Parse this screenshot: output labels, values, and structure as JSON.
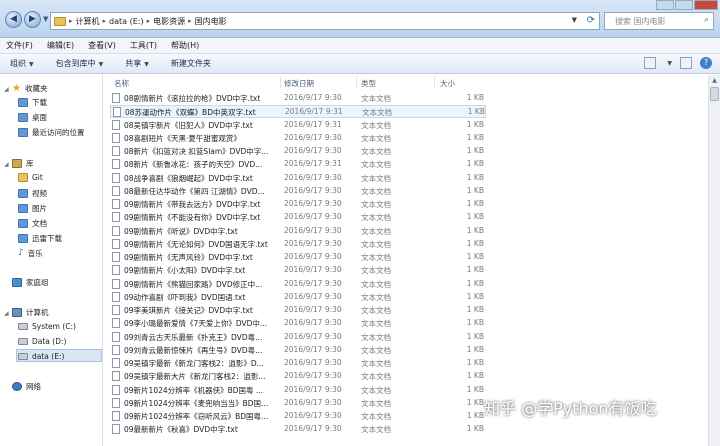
{
  "address_bar": {
    "crumbs": [
      "计算机",
      "data (E:)",
      "电影资源",
      "国内电影"
    ],
    "search_placeholder": "搜索 国内电影"
  },
  "menu": [
    "文件(F)",
    "编辑(E)",
    "查看(V)",
    "工具(T)",
    "帮助(H)"
  ],
  "toolbar": {
    "organize": "组织",
    "include": "包含到库中",
    "share": "共享",
    "new_folder": "新建文件夹"
  },
  "nav": {
    "favorites": "收藏夹",
    "downloads": "下载",
    "desktop": "桌面",
    "recent": "最近访问的位置",
    "libraries": "库",
    "git": "Git",
    "videos": "视频",
    "pictures": "图片",
    "documents": "文档",
    "thunder": "迅雷下载",
    "music": "音乐",
    "homegroup": "家庭组",
    "computer": "计算机",
    "drive_c": "System (C:)",
    "drive_d": "Data (D:)",
    "drive_e": "data (E:)",
    "network": "网络"
  },
  "columns": {
    "name": "名称",
    "date": "修改日期",
    "type": "类型",
    "size": "大小"
  },
  "files": [
    {
      "name": "08剧情新片《滚拉拉的枪》DVD中字.txt",
      "date": "2016/9/17 9:30",
      "type": "文本文档",
      "size": "1 KB"
    },
    {
      "name": "08苏運动作片《双蝶》BD中英双字.txt",
      "date": "2016/9/17 9:31",
      "type": "文本文档",
      "size": "1 KB"
    },
    {
      "name": "08吴镇宇新片《旧犯人》DVD中字.txt",
      "date": "2016/9/17 9:31",
      "type": "文本文档",
      "size": "1 KB"
    },
    {
      "name": "08喜剧短片《天黑·夏午甜蜜观赏》",
      "date": "2016/9/17 9:30",
      "type": "文本文档",
      "size": "1 KB"
    },
    {
      "name": "08新片《扣篮对决 扣篮Slam》DVD中字...",
      "date": "2016/9/17 9:30",
      "type": "文本文档",
      "size": "1 KB"
    },
    {
      "name": "08新片《新鲁冰花：孩子的天空》DVD...",
      "date": "2016/9/17 9:31",
      "type": "文本文档",
      "size": "1 KB"
    },
    {
      "name": "08战争喜剧《狼烟崛起》DVD中字.txt",
      "date": "2016/9/17 9:30",
      "type": "文本文档",
      "size": "1 KB"
    },
    {
      "name": "08最新任达华动作《第四 江湖情》DVD...",
      "date": "2016/9/17 9:30",
      "type": "文本文档",
      "size": "1 KB"
    },
    {
      "name": "09剧情新片《带我去远方》DVD中字.txt",
      "date": "2016/9/17 9:30",
      "type": "文本文档",
      "size": "1 KB"
    },
    {
      "name": "09剧情新片《不能没有你》DVD中字.txt",
      "date": "2016/9/17 9:30",
      "type": "文本文档",
      "size": "1 KB"
    },
    {
      "name": "09剧情新片《听说》DVD中字.txt",
      "date": "2016/9/17 9:30",
      "type": "文本文档",
      "size": "1 KB"
    },
    {
      "name": "09剧情新片《无论如何》DVD国语无字.txt",
      "date": "2016/9/17 9:30",
      "type": "文本文档",
      "size": "1 KB"
    },
    {
      "name": "09剧情新片《无声风铃》DVD中字.txt",
      "date": "2016/9/17 9:30",
      "type": "文本文档",
      "size": "1 KB"
    },
    {
      "name": "09剧情新片《小太阳》DVD中字.txt",
      "date": "2016/9/17 9:30",
      "type": "文本文档",
      "size": "1 KB"
    },
    {
      "name": "09剧情新片《熊猫回家路》DVD修正中...",
      "date": "2016/9/17 9:30",
      "type": "文本文档",
      "size": "1 KB"
    },
    {
      "name": "09动作喜剧《吓到我》DVD国语.txt",
      "date": "2016/9/17 9:30",
      "type": "文本文档",
      "size": "1 KB"
    },
    {
      "name": "09李美琪新片《接关记》DVD中字.txt",
      "date": "2016/9/17 9:30",
      "type": "文本文档",
      "size": "1 KB"
    },
    {
      "name": "09李小璐最新爱情《7天爱上你》DVD中...",
      "date": "2016/9/17 9:30",
      "type": "文本文档",
      "size": "1 KB"
    },
    {
      "name": "09刘青云古天乐最新《扑克王》DVD粤...",
      "date": "2016/9/17 9:30",
      "type": "文本文档",
      "size": "1 KB"
    },
    {
      "name": "09刘青云最新惊悚片《再生号》DVD粤...",
      "date": "2016/9/17 9:30",
      "type": "文本文档",
      "size": "1 KB"
    },
    {
      "name": "09吴镇宇最新《新龙门客栈2：逍影》D...",
      "date": "2016/9/17 9:30",
      "type": "文本文档",
      "size": "1 KB"
    },
    {
      "name": "09吴镇宇最新大片《新龙门客栈2：逍影...",
      "date": "2016/9/17 9:30",
      "type": "文本文档",
      "size": "1 KB"
    },
    {
      "name": "09新片1024分辨率《机器侠》BD国粤 ...",
      "date": "2016/9/17 9:30",
      "type": "文本文档",
      "size": "1 KB"
    },
    {
      "name": "09新片1024分辨率《麦兜响当当》BD国...",
      "date": "2016/9/17 9:30",
      "type": "文本文档",
      "size": "1 KB"
    },
    {
      "name": "09新片1024分辨率《窃听风云》BD国粤...",
      "date": "2016/9/17 9:30",
      "type": "文本文档",
      "size": "1 KB"
    },
    {
      "name": "09最新新片《秋喜》DVD中字.txt",
      "date": "2016/9/17 9:30",
      "type": "文本文档",
      "size": "1 KB"
    }
  ],
  "watermark": "知乎 @学Python有饭吃"
}
